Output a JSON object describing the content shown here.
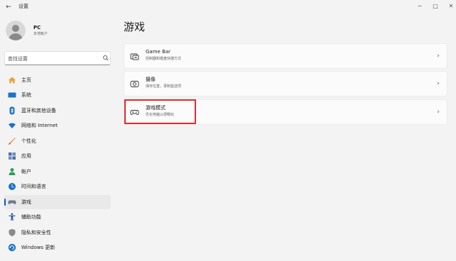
{
  "window": {
    "back_glyph": "←",
    "title": "设置",
    "min_glyph": "−",
    "max_glyph": "□",
    "close_glyph": "✕"
  },
  "profile": {
    "name": "PC",
    "account_type": "本地帐户"
  },
  "search": {
    "placeholder": "查找设置",
    "icon": "search-icon"
  },
  "sidebar": {
    "items": [
      {
        "label": "主页",
        "icon": "home-icon",
        "color": "#e8a13a",
        "active": false
      },
      {
        "label": "系统",
        "icon": "monitor-icon",
        "color": "#1a73c8",
        "active": false
      },
      {
        "label": "蓝牙和其他设备",
        "icon": "bluetooth-icon",
        "color": "#1a73c8",
        "active": false
      },
      {
        "label": "网络和 Internet",
        "icon": "wifi-icon",
        "color": "#1a73c8",
        "active": false
      },
      {
        "label": "个性化",
        "icon": "brush-icon",
        "color": "#e08a2c",
        "active": false
      },
      {
        "label": "应用",
        "icon": "apps-icon",
        "color": "#4a6fa5",
        "active": false
      },
      {
        "label": "帐户",
        "icon": "account-icon",
        "color": "#2e9e5b",
        "active": false
      },
      {
        "label": "时间和语言",
        "icon": "globe-clock-icon",
        "color": "#1a73c8",
        "active": false
      },
      {
        "label": "游戏",
        "icon": "gamepad-icon",
        "color": "#6b7a8f",
        "active": true
      },
      {
        "label": "辅助功能",
        "icon": "accessibility-icon",
        "color": "#1a4fa0",
        "active": false
      },
      {
        "label": "隐私和安全性",
        "icon": "shield-icon",
        "color": "#8a8a8a",
        "active": false
      },
      {
        "label": "Windows 更新",
        "icon": "update-icon",
        "color": "#1a73c8",
        "active": false
      }
    ]
  },
  "main": {
    "title": "游戏",
    "cards": [
      {
        "title": "Game Bar",
        "subtitle": "控制器和键盘快捷方式",
        "icon": "game-bar-icon"
      },
      {
        "title": "摄像",
        "subtitle": "保存位置，录制首选项",
        "icon": "capture-icon"
      },
      {
        "title": "游戏模式",
        "subtitle": "优化电脑以便畅玩",
        "icon": "game-mode-icon"
      }
    ],
    "chevron": "›",
    "highlight_color": "#e02b2b"
  },
  "colors": {
    "accent": "#005fb8",
    "background": "#f3f3f3",
    "card": "#fbfbfb"
  }
}
